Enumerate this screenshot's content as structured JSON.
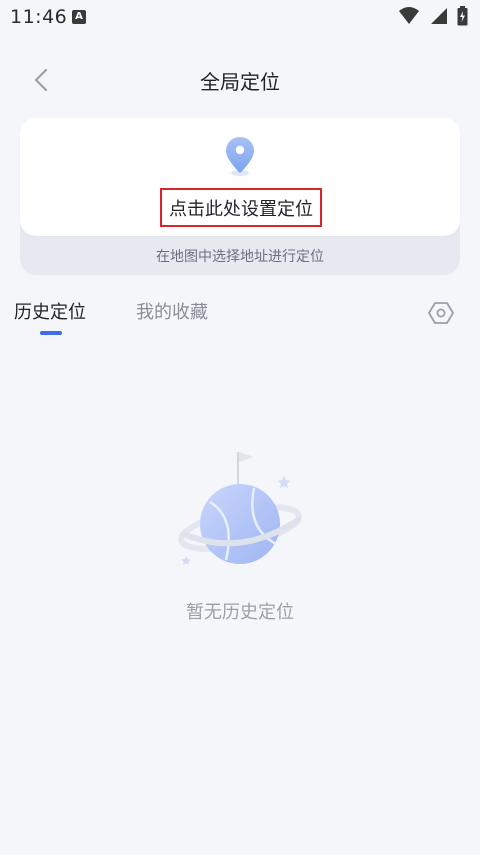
{
  "status_bar": {
    "time": "11:46",
    "notification_icon_letter": "A",
    "icons": [
      "wifi-icon",
      "signal-icon",
      "battery-charging-icon"
    ]
  },
  "header": {
    "back_icon": "chevron-left-icon",
    "title": "全局定位"
  },
  "location_card": {
    "pin_icon": "location-pin-icon",
    "action_label": "点击此处设置定位",
    "hint": "在地图中选择地址进行定位",
    "highlight_color": "#d9262c"
  },
  "tabs": {
    "items": [
      {
        "label": "历史定位",
        "active": true
      },
      {
        "label": "我的收藏",
        "active": false
      }
    ],
    "accent_color": "#3f6ee8",
    "settings_icon": "hexagon-settings-icon"
  },
  "empty_state": {
    "illustration": "planet-with-flag-illustration",
    "text": "暂无历史定位"
  }
}
